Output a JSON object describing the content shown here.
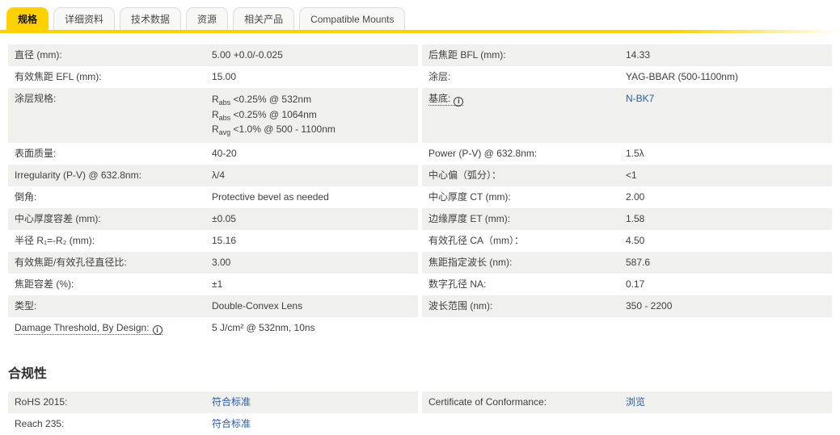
{
  "colors": {
    "accent": "#FFD100",
    "link": "#2a5ca8",
    "stripe": "#f0f0ef",
    "text": "#3f3f3f"
  },
  "tabs": [
    {
      "name": "tab-specs",
      "label": "规格",
      "active": true
    },
    {
      "name": "tab-details",
      "label": "详细资料",
      "active": false
    },
    {
      "name": "tab-technical-data",
      "label": "技术数据",
      "active": false
    },
    {
      "name": "tab-resources",
      "label": "资源",
      "active": false
    },
    {
      "name": "tab-related-products",
      "label": "相关产品",
      "active": false
    },
    {
      "name": "tab-compatible-mounts",
      "label": "Compatible Mounts",
      "active": false
    }
  ],
  "spec_table": {
    "rows": [
      {
        "left": {
          "label": "直径 (mm):",
          "value": "5.00 +0.0/-0.025"
        },
        "right": {
          "label": "后焦距 BFL (mm):",
          "value": "14.33"
        }
      },
      {
        "left": {
          "label": "有效焦距 EFL (mm):",
          "value": "15.00"
        },
        "right": {
          "label": "涂层:",
          "value": "YAG-BBAR (500-1100nm)"
        }
      },
      {
        "left": {
          "label": "涂层规格:",
          "value_lines": [
            {
              "base": "R",
              "sub": "abs",
              "rest": " <0.25% @ 532nm"
            },
            {
              "base": "R",
              "sub": "abs",
              "rest": " <0.25% @ 1064nm"
            },
            {
              "base": "R",
              "sub": "avg",
              "rest": " <1.0% @ 500 - 1100nm"
            }
          ]
        },
        "right": {
          "label": "基底:",
          "dotted": true,
          "info": true,
          "value": "N-BK7",
          "link": true
        }
      },
      {
        "left": {
          "label": "表面质量:",
          "value": "40-20"
        },
        "right": {
          "label": "Power (P-V) @ 632.8nm:",
          "value": "1.5λ"
        }
      },
      {
        "left": {
          "label": "Irregularity (P-V) @ 632.8nm:",
          "value": "λ/4"
        },
        "right": {
          "label": "中心偏（弧分）：",
          "value": "<1"
        }
      },
      {
        "left": {
          "label": "倒角:",
          "value": "Protective bevel as needed"
        },
        "right": {
          "label": "中心厚度 CT (mm):",
          "value": "2.00"
        }
      },
      {
        "left": {
          "label": "中心厚度容差 (mm):",
          "value": "±0.05"
        },
        "right": {
          "label": "边缘厚度 ET (mm):",
          "value": "1.58"
        }
      },
      {
        "left": {
          "label": "半径 R₁=-R₂ (mm):",
          "value": "15.16"
        },
        "right": {
          "label": "有效孔径 CA（mm）：",
          "value": "4.50"
        }
      },
      {
        "left": {
          "label": "有效焦距/有效孔径直径比:",
          "value": "3.00"
        },
        "right": {
          "label": "焦距指定波长 (nm):",
          "value": "587.6"
        }
      },
      {
        "left": {
          "label": "焦距容差 (%):",
          "value": "±1"
        },
        "right": {
          "label": "数字孔径 NA:",
          "value": "0.17"
        }
      },
      {
        "left": {
          "label": "类型:",
          "value": "Double-Convex Lens"
        },
        "right": {
          "label": "波长范围 (nm):",
          "value": "350 - 2200"
        }
      },
      {
        "left": {
          "label": "Damage Threshold, By Design:",
          "dotted": true,
          "info": true,
          "value": "5 J/cm² @ 532nm, 10ns"
        },
        "right": null
      }
    ]
  },
  "compliance": {
    "heading": "合规性",
    "rows": [
      {
        "left": {
          "label": "RoHS 2015:",
          "value": "符合标准",
          "link": true
        },
        "right": {
          "label": "Certificate of Conformance:",
          "value": "浏览",
          "link": true
        }
      },
      {
        "left": {
          "label": "Reach 235:",
          "value": "符合标准",
          "link": true
        },
        "right": null
      }
    ]
  }
}
